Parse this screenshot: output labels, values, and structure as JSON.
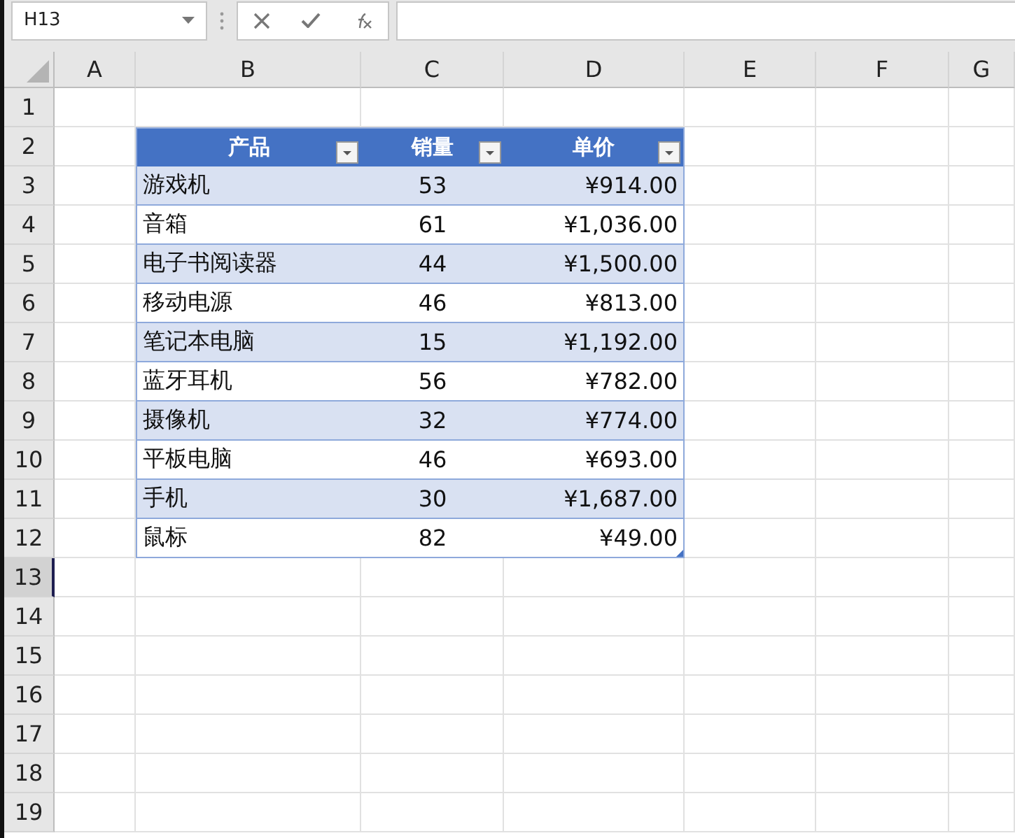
{
  "name_box": {
    "value": "H13"
  },
  "columns": [
    {
      "label": "A"
    },
    {
      "label": "B"
    },
    {
      "label": "C"
    },
    {
      "label": "D"
    },
    {
      "label": "E"
    },
    {
      "label": "F"
    },
    {
      "label": "G"
    }
  ],
  "rows": [
    {
      "label": "1",
      "selected": false
    },
    {
      "label": "2",
      "selected": false
    },
    {
      "label": "3",
      "selected": false
    },
    {
      "label": "4",
      "selected": false
    },
    {
      "label": "5",
      "selected": false
    },
    {
      "label": "6",
      "selected": false
    },
    {
      "label": "7",
      "selected": false
    },
    {
      "label": "8",
      "selected": false
    },
    {
      "label": "9",
      "selected": false
    },
    {
      "label": "10",
      "selected": false
    },
    {
      "label": "11",
      "selected": false
    },
    {
      "label": "12",
      "selected": false
    },
    {
      "label": "13",
      "selected": true
    },
    {
      "label": "14",
      "selected": false
    },
    {
      "label": "15",
      "selected": false
    },
    {
      "label": "16",
      "selected": false
    },
    {
      "label": "17",
      "selected": false
    },
    {
      "label": "18",
      "selected": false
    },
    {
      "label": "19",
      "selected": false
    }
  ],
  "table": {
    "headers": [
      "产品",
      "销量",
      "单价"
    ],
    "rows": [
      [
        "游戏机",
        "53",
        "¥914.00"
      ],
      [
        "音箱",
        "61",
        "¥1,036.00"
      ],
      [
        "电子书阅读器",
        "44",
        "¥1,500.00"
      ],
      [
        "移动电源",
        "46",
        "¥813.00"
      ],
      [
        "笔记本电脑",
        "15",
        "¥1,192.00"
      ],
      [
        "蓝牙耳机",
        "56",
        "¥782.00"
      ],
      [
        "摄像机",
        "32",
        "¥774.00"
      ],
      [
        "平板电脑",
        "46",
        "¥693.00"
      ],
      [
        "手机",
        "30",
        "¥1,687.00"
      ],
      [
        "鼠标",
        "82",
        "¥49.00"
      ]
    ]
  }
}
